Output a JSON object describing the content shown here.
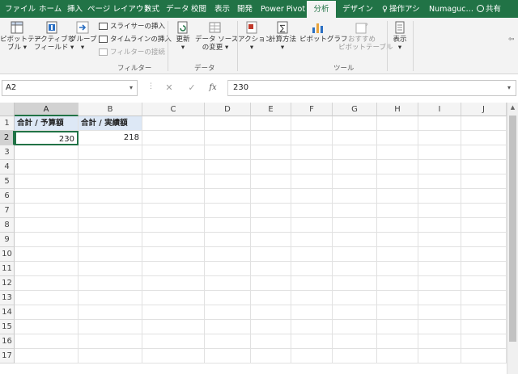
{
  "tabs": [
    {
      "label": "ファイル",
      "active": false
    },
    {
      "label": "ホーム",
      "active": false
    },
    {
      "label": "挿入",
      "active": false
    },
    {
      "label": "ページ レイアウト",
      "active": false
    },
    {
      "label": "数式",
      "active": false
    },
    {
      "label": "データ",
      "active": false
    },
    {
      "label": "校閲",
      "active": false
    },
    {
      "label": "表示",
      "active": false
    },
    {
      "label": "開発",
      "active": false
    },
    {
      "label": "Power Pivot",
      "active": false
    },
    {
      "label": "分析",
      "active": true
    },
    {
      "label": "デザイン",
      "active": false
    },
    {
      "label": "操作アシ",
      "active": false
    },
    {
      "label": "Numaguc…",
      "active": false
    }
  ],
  "share_label": "共有",
  "ribbon": {
    "pivot_table": "ピボットテー\nブル ▾",
    "active_field": "アクティブな\nフィールド ▾",
    "group": "グループ\n▾",
    "insert_slicer": "スライサーの挿入",
    "insert_timeline": "タイムラインの挿入",
    "filter_connections": "フィルターの接続",
    "filter_group": "フィルター",
    "refresh": "更新\n▾",
    "change_data_source": "データ ソース\nの変更 ▾",
    "data_group": "データ",
    "actions": "アクション\n▾",
    "calculations": "計算方法\n▾",
    "pivot_chart": "ピボットグラフ",
    "recommended_pivot": "おすすめ\nピボットテーブル",
    "tools_group": "ツール",
    "show": "表示\n▾"
  },
  "formula_bar": {
    "name_box": "A2",
    "content": "230",
    "fx": "fx"
  },
  "columns": [
    "A",
    "B",
    "C",
    "D",
    "E",
    "F",
    "G",
    "H",
    "I",
    "J"
  ],
  "rows": [
    "1",
    "2",
    "3",
    "4",
    "5",
    "6",
    "7",
    "8",
    "9",
    "10",
    "11",
    "12",
    "13",
    "14",
    "15",
    "16",
    "17"
  ],
  "cells": {
    "A1": "合計 / 予算額",
    "B1": "合計 / 実績額",
    "A2": "230",
    "B2": "218"
  },
  "colors": {
    "accent": "#217346",
    "pivot_header": "#dde8f6"
  }
}
